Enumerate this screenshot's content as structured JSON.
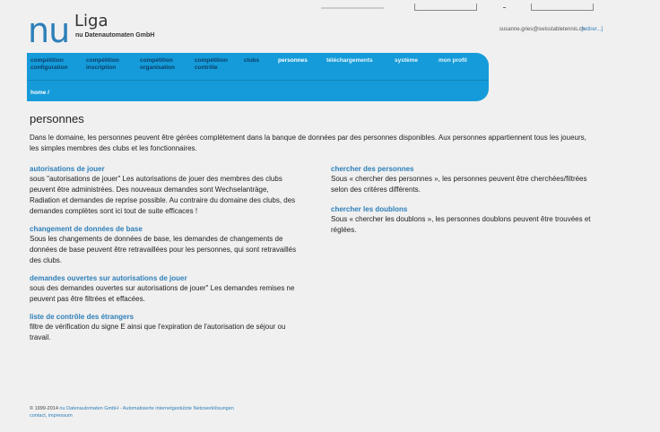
{
  "header": {
    "logo_main": "nu",
    "logo_name": "Liga",
    "logo_sub": "nu Datenautomaten GmbH",
    "user_email": "susanne.gries@swisstabletennis.ch",
    "logout_label": "[retirer...]"
  },
  "nav": {
    "items": [
      {
        "line1": "compétition",
        "line2": "configuration"
      },
      {
        "line1": "compétition",
        "line2": "inscription"
      },
      {
        "line1": "compétition",
        "line2": "organisation"
      },
      {
        "line1": "compétition",
        "line2": "contrôle"
      },
      {
        "line1": "clubs",
        "line2": ""
      },
      {
        "line1": "personnes",
        "line2": ""
      },
      {
        "line1": "téléchargements",
        "line2": ""
      },
      {
        "line1": "système",
        "line2": ""
      },
      {
        "line1": "mon profil",
        "line2": ""
      }
    ],
    "breadcrumb": "home /"
  },
  "main": {
    "title": "personnes",
    "intro": "Dans le domaine, les personnes peuvent être gérées complètement dans la banque de données par des personnes disponibles. Aux personnes appartiennent tous les joueurs, les simples membres des clubs et les fonctionnaires.",
    "left_sections": [
      {
        "title": "autorisations de jouer",
        "text": "sous \"autorisations de jouer\" Les autorisations de jouer des membres des clubs peuvent être administrées. Des nouveaux demandes sont Wechselanträge, Radiation et demandes de reprise possible. Au contraire du domaine des clubs, des demandes complètes sont ici tout de suite efficaces !"
      },
      {
        "title": "changement de données de base",
        "text": "Sous les changements de données de base, les demandes de changements de données de base peuvent être retravaillées pour les personnes, qui sont retravaillés des clubs."
      },
      {
        "title": "demandes ouvertes sur autorisations de jouer",
        "text": "sous des demandes ouvertes sur autorisations de jouer\" Les demandes remises ne peuvent pas être filtrées et effacées."
      },
      {
        "title": "liste de contrôle des étrangers",
        "text": "filtre de vérification du signe E ainsi que l'expiration de l'autorisation de séjour ou travail."
      }
    ],
    "right_sections": [
      {
        "title": "chercher des personnes",
        "text": "Sous « chercher des personnes », les personnes peuvent être cherchées/filtrées selon des critères différents."
      },
      {
        "title": "chercher les doublons",
        "text": "Sous « chercher les doublons », les personnes doublons peuvent être trouvées et réglées."
      }
    ]
  },
  "footer": {
    "copyright": "© 1999-2014",
    "company_link": "nu Datenautomaten GmbH - Automatisierte internetgestützte Netzwerklösungen",
    "contact_link": "contact",
    "impressum_link": "impressum"
  },
  "colors": {
    "accent": "#2d7fb8",
    "nav_bg": "#159bd9",
    "page_bg": "#f0f0f0"
  }
}
